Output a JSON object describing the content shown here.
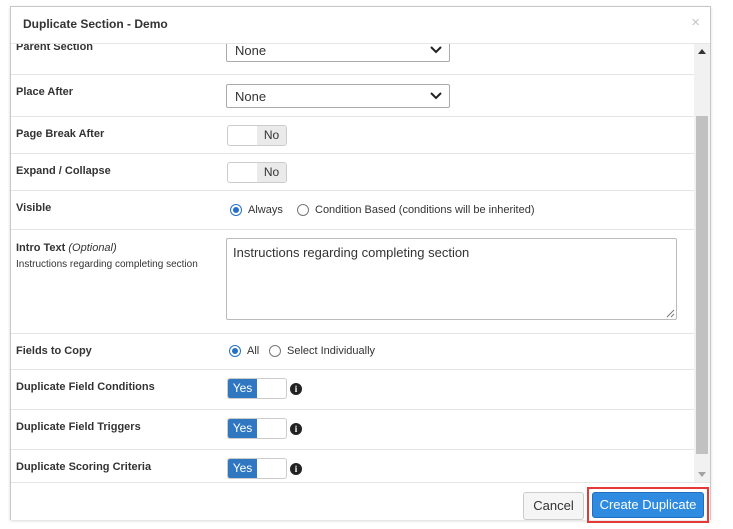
{
  "modal": {
    "title": "Duplicate Section - Demo",
    "close_glyph": "×"
  },
  "fields": {
    "parent_section": {
      "label": "Parent Section",
      "value": "None"
    },
    "place_after": {
      "label": "Place After",
      "value": "None"
    },
    "page_break_after": {
      "label": "Page Break After",
      "toggle": "No"
    },
    "expand_collapse": {
      "label": "Expand / Collapse",
      "toggle": "No"
    },
    "visible": {
      "label": "Visible",
      "options": [
        "Always",
        "Condition Based (conditions will be inherited)"
      ],
      "selected": "Always"
    },
    "intro_text": {
      "label": "Intro Text",
      "optional": "(Optional)",
      "help": "Instructions regarding completing section",
      "value": "Instructions regarding completing section"
    },
    "fields_to_copy": {
      "label": "Fields to Copy",
      "options": [
        "All",
        "Select Individually"
      ],
      "selected": "All"
    },
    "duplicate_field_conditions": {
      "label": "Duplicate Field Conditions",
      "toggle": "Yes"
    },
    "duplicate_field_triggers": {
      "label": "Duplicate Field Triggers",
      "toggle": "Yes"
    },
    "duplicate_scoring_criteria": {
      "label": "Duplicate Scoring Criteria",
      "toggle": "Yes"
    }
  },
  "icons": {
    "info": "info-icon",
    "chevron": "chevron-down-icon"
  },
  "footer": {
    "cancel_label": "Cancel",
    "create_label": "Create Duplicate"
  },
  "colors": {
    "accent": "#2f77c1",
    "primary_button": "#2f8be0",
    "highlight_border": "#e53935"
  }
}
